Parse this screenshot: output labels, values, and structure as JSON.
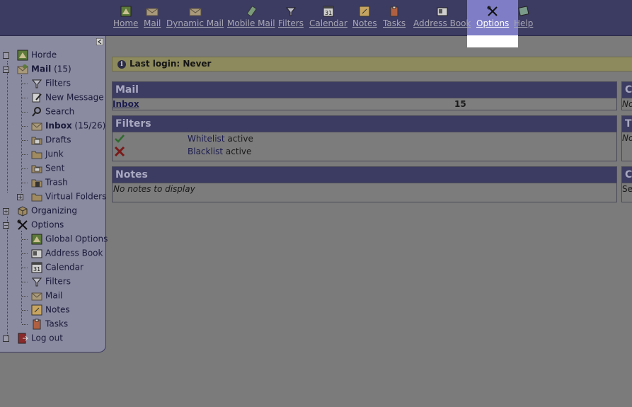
{
  "nav": {
    "home": "Home",
    "mail": "Mail",
    "dynamic_mail": "Dynamic Mail",
    "mobile_mail": "Mobile Mail",
    "filters": "Filters",
    "calendar": "Calendar",
    "calendar_icon_day": "31",
    "notes": "Notes",
    "tasks": "Tasks",
    "address_book": "Address Book",
    "options": "Options",
    "help": "Help"
  },
  "sidebar": {
    "horde": "Horde",
    "mail": "Mail",
    "mail_count": "(15)",
    "filters": "Filters",
    "new_message": "New Message",
    "search": "Search",
    "inbox": "Inbox",
    "inbox_count": "(15/26)",
    "drafts": "Drafts",
    "junk": "Junk",
    "sent": "Sent",
    "trash": "Trash",
    "virtual_folders": "Virtual Folders",
    "organizing": "Organizing",
    "options": "Options",
    "global_options": "Global Options",
    "address_book": "Address Book",
    "calendar": "Calendar",
    "options_filters": "Filters",
    "options_mail": "Mail",
    "notes": "Notes",
    "tasks": "Tasks",
    "log_out": "Log out"
  },
  "last_login": "Last login: Never",
  "mail_portlet": {
    "title": "Mail",
    "inbox_label": "Inbox",
    "inbox_count": "15"
  },
  "filters_portlet": {
    "title": "Filters",
    "whitelist_link": "Whitelist",
    "whitelist_status": "active",
    "blacklist_link": "Blacklist",
    "blacklist_status": "active"
  },
  "notes_portlet": {
    "title": "Notes",
    "empty": "No notes to display"
  },
  "right_portlets": {
    "first_title": "C",
    "first_text": "No",
    "second_title": "T",
    "second_text": "No",
    "third_title": "C",
    "third_text": "Se"
  },
  "colors": {
    "header_bar": "#3c3b62",
    "options_highlight": "#7e7dc6",
    "sidebar_bg": "#8a8aa0",
    "last_login_bg": "#8d8a5e"
  }
}
